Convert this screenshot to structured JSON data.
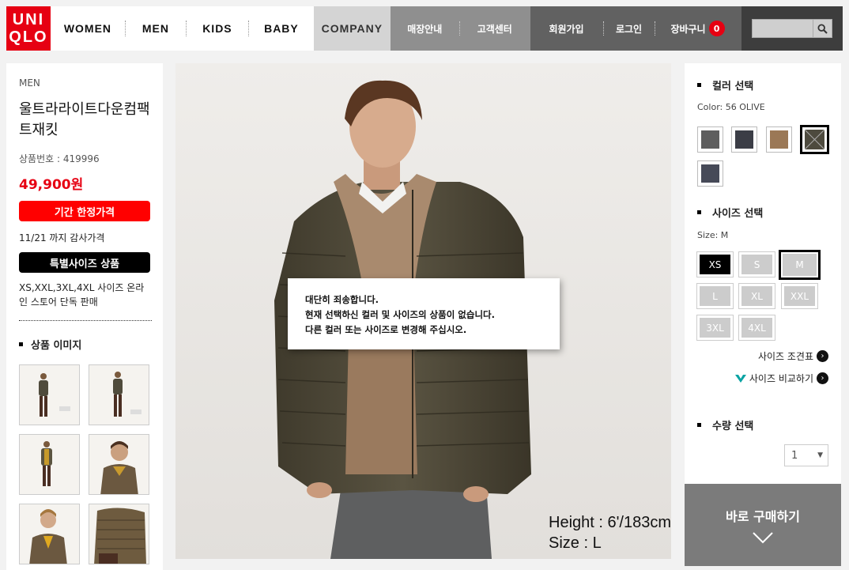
{
  "header": {
    "logo_line1": "UNI",
    "logo_line2": "QLO",
    "nav": [
      "WOMEN",
      "MEN",
      "KIDS",
      "BABY"
    ],
    "company": "COMPANY",
    "store_info": "매장안내",
    "customer_center": "고객센터",
    "signup": "회원가입",
    "login": "로그인",
    "cart": "장바구니",
    "cart_count": "0",
    "search_placeholder": ""
  },
  "product": {
    "category": "MEN",
    "name": "울트라라이트다운컴팩트재킷",
    "number": "상품번호 : 419996",
    "price": "49,900원",
    "limited_badge": "기간 한정가격",
    "limited_note": "11/21 까지 감사가격",
    "special_size_badge": "특별사이즈 상품",
    "special_size_note": "XS,XXL,3XL,4XL 사이즈 온라인 스토어 단독 판매",
    "images_heading": "상품 이미지"
  },
  "main_image": {
    "popup_lines": [
      "대단히 죄송합니다.",
      "현재 선택하신 컬러 및 사이즈의 상품이 없습니다.",
      "다른 컬러 또는 사이즈로 변경해 주십시오."
    ],
    "height_label": "Height : 6'/183cm",
    "size_label": "Size : L"
  },
  "options": {
    "color_heading": "컬러 선택",
    "color_selected": "Color: 56 OLIVE",
    "colors": [
      "#5e5e5e",
      "#3b3d46",
      "#9b7856",
      "#4d4a3e",
      "#464a58"
    ],
    "size_heading": "사이즈 선택",
    "size_selected": "Size: M",
    "sizes": [
      "XS",
      "S",
      "M",
      "L",
      "XL",
      "XXL",
      "3XL",
      "4XL"
    ],
    "size_chart": "사이즈 조견표",
    "size_compare": "사이즈 비교하기",
    "qty_heading": "수량 선택",
    "qty_value": "1",
    "buy_now": "바로 구매하기"
  }
}
